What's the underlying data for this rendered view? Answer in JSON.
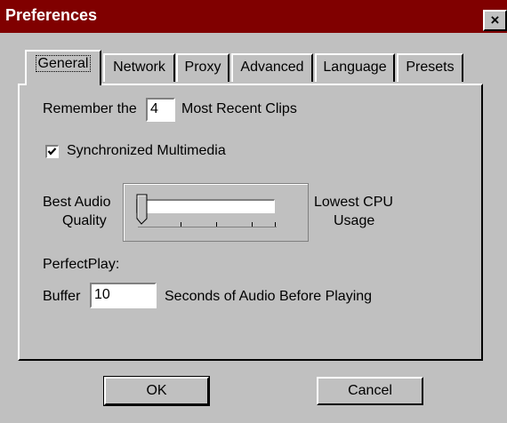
{
  "window": {
    "title": "Preferences",
    "close_glyph": "×"
  },
  "tabs": [
    {
      "label": "General",
      "active": true
    },
    {
      "label": "Network"
    },
    {
      "label": "Proxy"
    },
    {
      "label": "Advanced"
    },
    {
      "label": "Language"
    },
    {
      "label": "Presets"
    }
  ],
  "general": {
    "remember_prefix": "Remember the",
    "clips_value": "4",
    "remember_suffix": "Most Recent Clips",
    "sync_checked": true,
    "sync_label": "Synchronized Multimedia",
    "slider_left_label_1": "Best Audio",
    "slider_left_label_2": "Quality",
    "slider_right_label_1": "Lowest CPU",
    "slider_right_label_2": "Usage",
    "slider_level": 0,
    "perfectplay_heading": "PerfectPlay:",
    "buffer_label": "Buffer",
    "buffer_value": "10",
    "buffer_suffix": "Seconds of Audio Before Playing"
  },
  "buttons": {
    "ok": "OK",
    "cancel": "Cancel"
  },
  "colors": {
    "titlebar": "#800000",
    "face": "#c0c0c0"
  }
}
